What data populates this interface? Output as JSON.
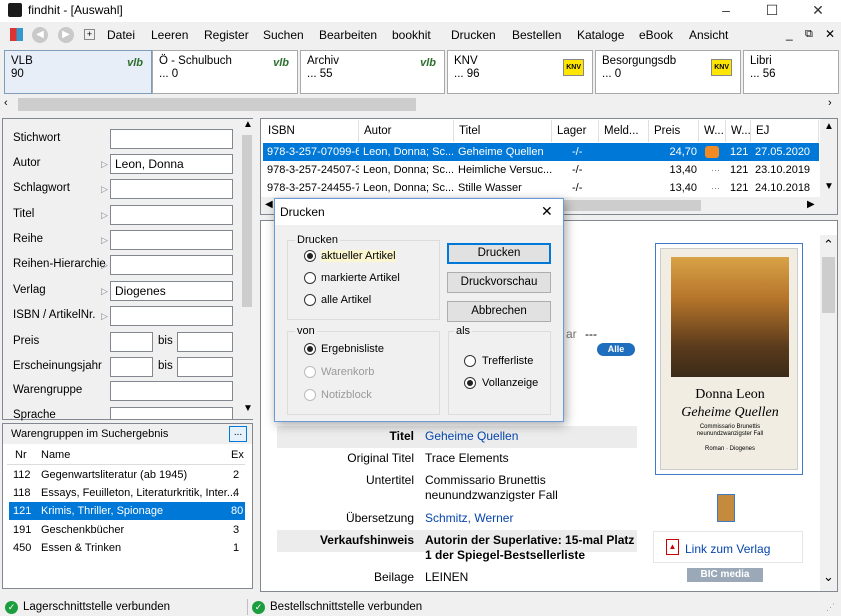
{
  "window": {
    "title": "findhit - [Auswahl]"
  },
  "menu": [
    "Datei",
    "Leeren",
    "Register",
    "Suchen",
    "Bearbeiten",
    "bookhit",
    "Drucken",
    "Bestellen",
    "Kataloge",
    "eBook",
    "Ansicht"
  ],
  "sources": [
    {
      "name": "VLB",
      "count": "90",
      "logo": "vlb"
    },
    {
      "name": "Ö - Schulbuch",
      "count": "... 0",
      "logo": "vlb"
    },
    {
      "name": "Archiv",
      "count": "... 55",
      "logo": "vlb"
    },
    {
      "name": "KNV",
      "count": "... 96",
      "logo": "KNV"
    },
    {
      "name": "Besorgungsdb",
      "count": "... 0",
      "logo": "KNV"
    },
    {
      "name": "Libri",
      "count": "... 56",
      "logo": ""
    }
  ],
  "search": {
    "labels": [
      "Stichwort",
      "Autor",
      "Schlagwort",
      "Titel",
      "Reihe",
      "Reihen-Hierarchie",
      "Verlag",
      "ISBN / ArtikelNr.",
      "Preis",
      "Erscheinungsjahr",
      "Warengruppe",
      "Sprache"
    ],
    "values": {
      "autor": "Leon, Donna",
      "verlag": "Diogenes"
    },
    "bis": "bis"
  },
  "warengruppen": {
    "title": "Warengruppen im Suchergebnis",
    "browse": "...",
    "headers": [
      "Nr",
      "Name",
      "Ex"
    ],
    "rows": [
      {
        "nr": "112",
        "name": "Gegenwartsliteratur (ab 1945)",
        "ex": "2"
      },
      {
        "nr": "118",
        "name": "Essays, Feuilleton, Literaturkritik, Inter...",
        "ex": "4"
      },
      {
        "nr": "121",
        "name": "Krimis, Thriller, Spionage",
        "ex": "80"
      },
      {
        "nr": "191",
        "name": "Geschenkbücher",
        "ex": "3"
      },
      {
        "nr": "450",
        "name": "Essen & Trinken",
        "ex": "1"
      }
    ]
  },
  "grid": {
    "headers": [
      "ISBN",
      "Autor",
      "Titel",
      "Lager",
      "Meld...",
      "Preis",
      "W...",
      "W...",
      "EJ"
    ],
    "rows": [
      {
        "isbn": "978-3-257-07099-6",
        "autor": "Leon, Donna; Sc...",
        "titel": "Geheime Quellen",
        "lager": "-/-",
        "meld": "",
        "preis": "24,70",
        "wg": "121",
        "ej": "27.05.2020"
      },
      {
        "isbn": "978-3-257-24507-3",
        "autor": "Leon, Donna; Sc...",
        "titel": "Heimliche Versuc...",
        "lager": "-/-",
        "meld": "",
        "preis": "13,40",
        "wg": "121",
        "ej": "23.10.2019"
      },
      {
        "isbn": "978-3-257-24455-7",
        "autor": "Leon, Donna; Sc...",
        "titel": "Stille Wasser",
        "lager": "-/-",
        "meld": "",
        "preis": "13,40",
        "wg": "121",
        "ej": "24.10.2018"
      }
    ]
  },
  "detail": {
    "partial_label": "ar",
    "partial_value": "---",
    "alle_badge": "Alle",
    "fields": [
      {
        "label": "Titel",
        "value": "Geheime Quellen",
        "link": true
      },
      {
        "label": "Original Titel",
        "value": "Trace Elements",
        "link": false
      },
      {
        "label": "Untertitel",
        "value": "Commissario Brunettis neunundzwanzigster Fall",
        "link": false
      },
      {
        "label": "Übersetzung",
        "value": "Schmitz, Werner",
        "link": true
      },
      {
        "label": "Verkaufshinweis",
        "value": "Autorin der Superlative: 15-mal Platz 1 der Spiegel-Bestsellerliste",
        "link": false
      },
      {
        "label": "Beilage",
        "value": "LEINEN",
        "link": false
      }
    ],
    "cover": {
      "author": "Donna Leon",
      "title": "Geheime Quellen",
      "subtitle": "Commissario Brunettis neunundzwanzigster Fall",
      "publisher": "Roman · Diogenes"
    },
    "verlag_link": "Link zum Verlag",
    "bic": "BIC media"
  },
  "dialog": {
    "title": "Drucken",
    "group1": "Drucken",
    "opts1": [
      "aktueller Artikel",
      "markierte Artikel",
      "alle Artikel"
    ],
    "group2": "von",
    "opts2": [
      "Ergebnisliste",
      "Warenkorb",
      "Notizblock"
    ],
    "group3": "als",
    "opts3": [
      "Trefferliste",
      "Vollanzeige"
    ],
    "buttons": [
      "Drucken",
      "Druckvorschau",
      "Abbrechen"
    ]
  },
  "status": [
    "Lagerschnittstelle verbunden",
    "Bestellschnittstelle verbunden"
  ],
  "colors": {
    "selection": "#0078d7",
    "link": "#0645ad",
    "ok": "#1d9e3e"
  }
}
